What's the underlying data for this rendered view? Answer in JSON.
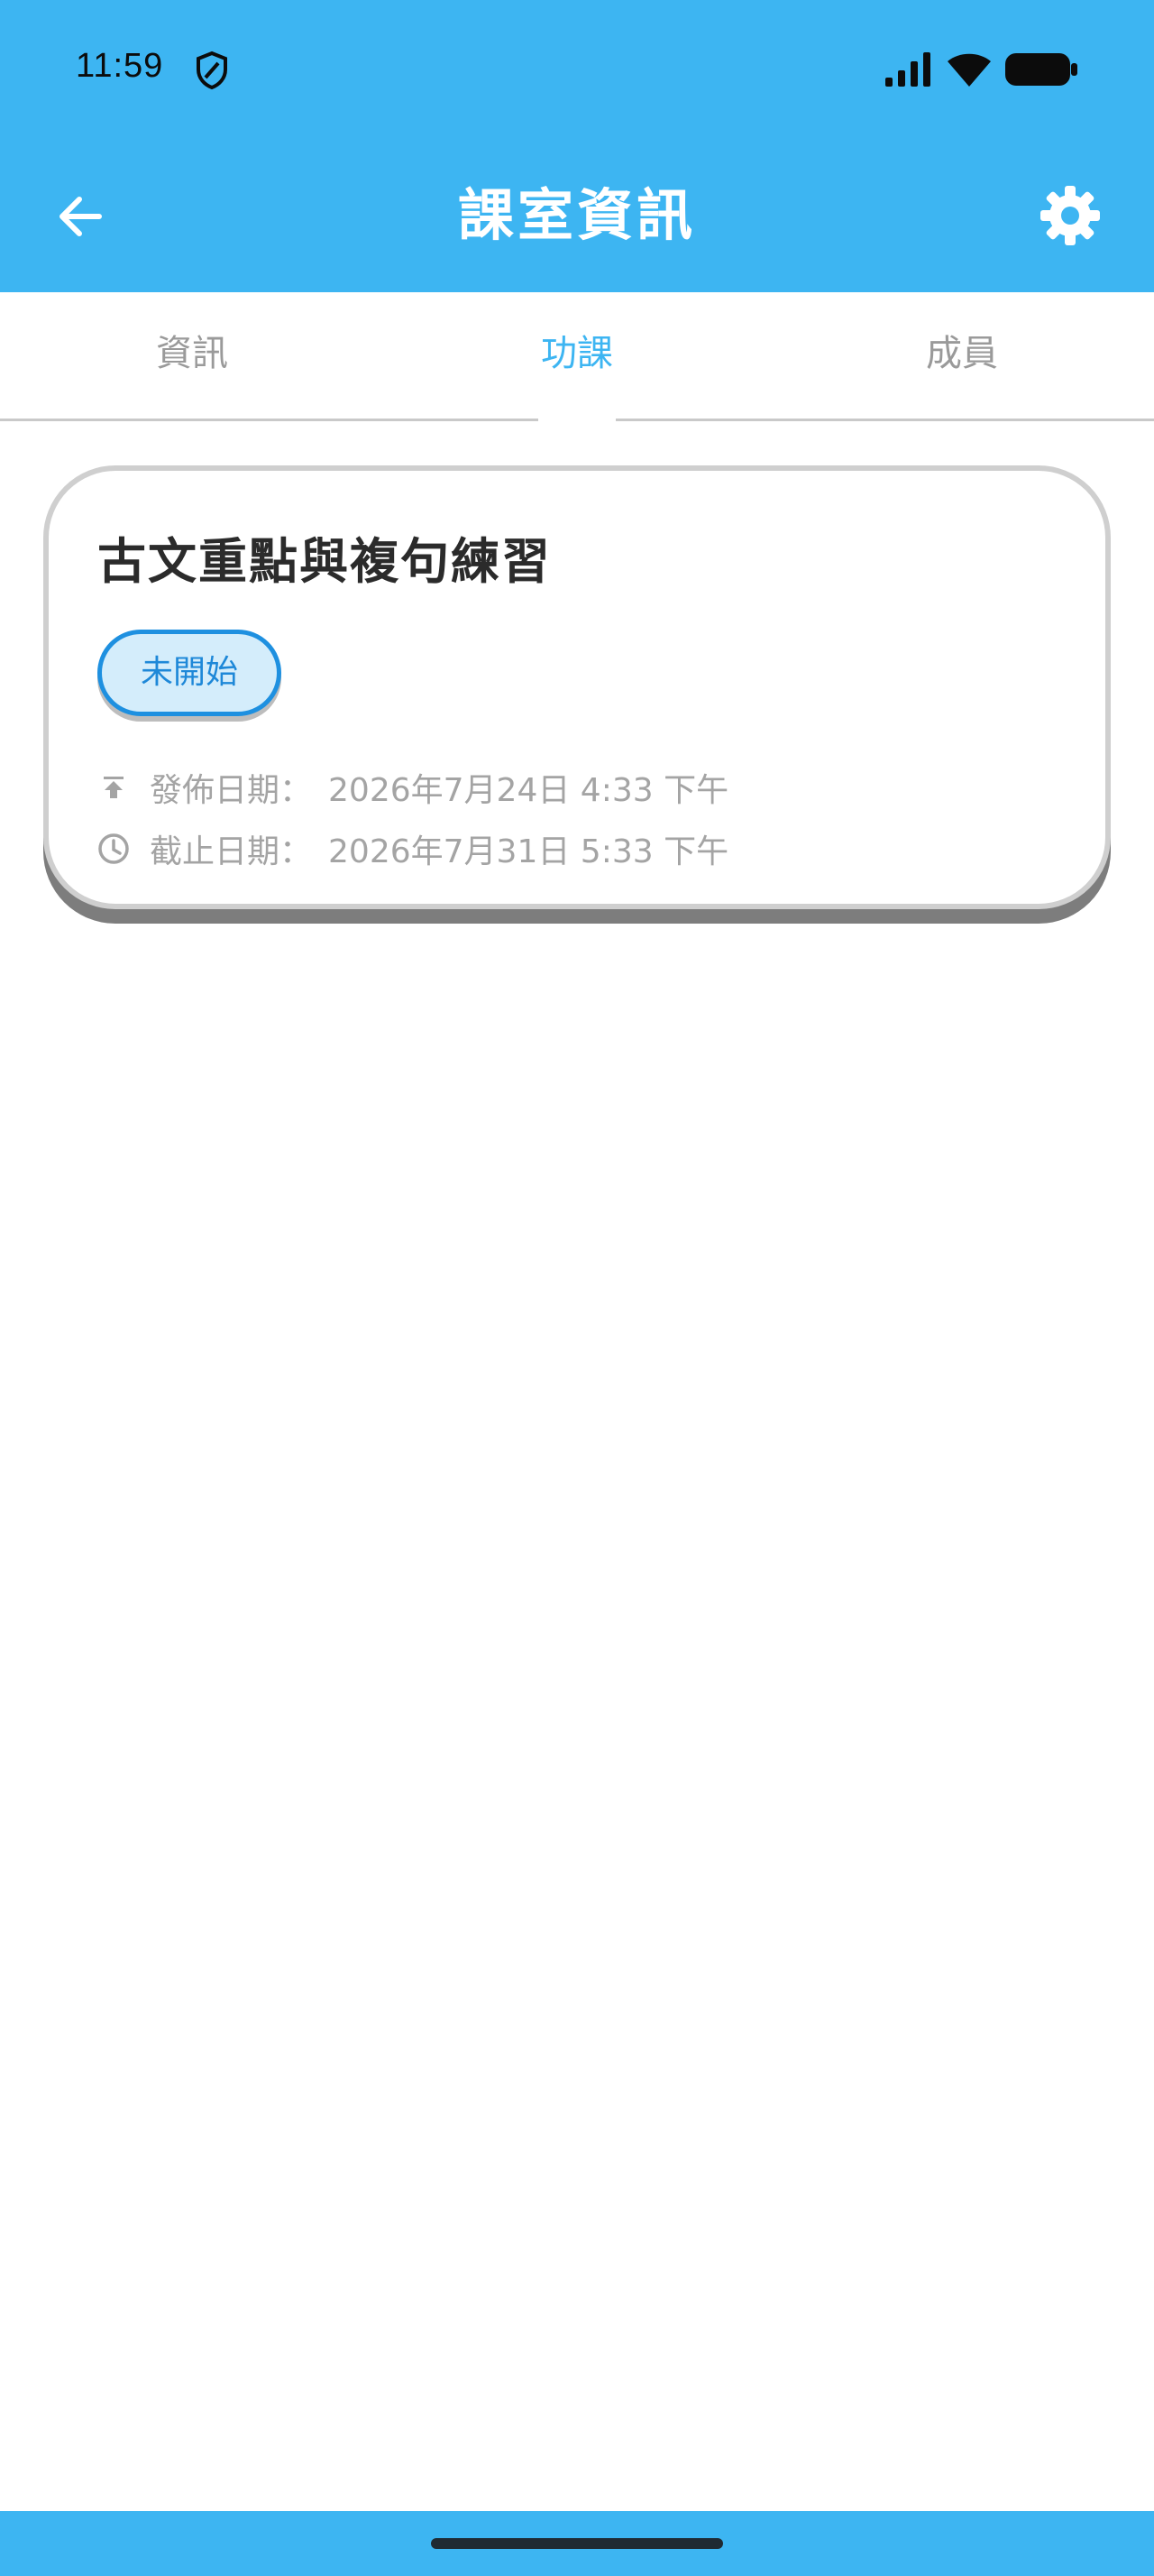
{
  "status_bar": {
    "time": "11:59",
    "icons": [
      "shield-icon",
      "signal-icon",
      "wifi-icon",
      "battery-icon"
    ]
  },
  "app_bar": {
    "title": "課室資訊",
    "back_icon": "arrow-left-icon",
    "settings_icon": "gear-icon"
  },
  "tabs": [
    {
      "label": "資訊",
      "active": false
    },
    {
      "label": "功課",
      "active": true
    },
    {
      "label": "成員",
      "active": false
    }
  ],
  "assignments": [
    {
      "title": "古文重點與複句練習",
      "status": "未開始",
      "publish_label": "發佈日期：",
      "publish_date": "2026年7月24日 4:33 下午",
      "due_label": "截止日期：",
      "due_date": "2026年7月31日 5:33 下午"
    }
  ],
  "colors": {
    "primary": "#3db5f2",
    "chip_bg": "#d4edfb",
    "chip_border": "#1e90e0",
    "muted_text": "#a4a4a4"
  }
}
